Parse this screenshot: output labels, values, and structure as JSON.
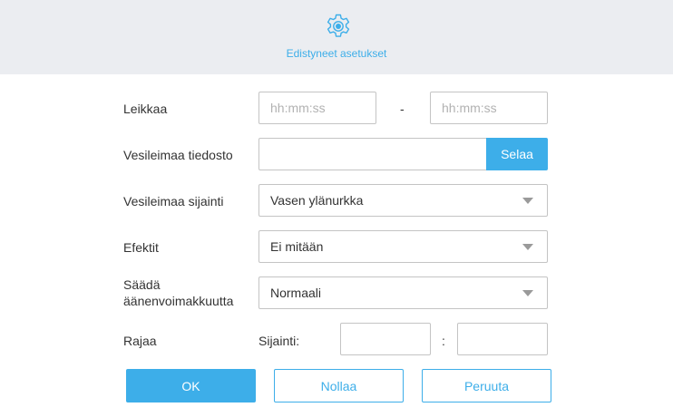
{
  "header": {
    "icon": "gear-icon",
    "title": "Edistyneet asetukset"
  },
  "accent_color": "#3daee9",
  "form": {
    "trim": {
      "label": "Leikkaa",
      "start_placeholder": "hh:mm:ss",
      "end_placeholder": "hh:mm:ss",
      "separator": "-"
    },
    "watermark_file": {
      "label": "Vesileimaa tiedosto",
      "value": "",
      "browse_label": "Selaa"
    },
    "watermark_position": {
      "label": "Vesileimaa sijainti",
      "selected": "Vasen ylänurkka"
    },
    "effects": {
      "label": "Efektit",
      "selected": "Ei mitään"
    },
    "volume": {
      "label_line1": "Säädä",
      "label_line2": "äänenvoimakkuutta",
      "selected": "Normaali"
    },
    "crop": {
      "label": "Rajaa",
      "position_label": "Sijainti:",
      "separator": ":",
      "x_value": "",
      "y_value": ""
    }
  },
  "buttons": {
    "ok": "OK",
    "reset": "Nollaa",
    "cancel": "Peruuta"
  }
}
